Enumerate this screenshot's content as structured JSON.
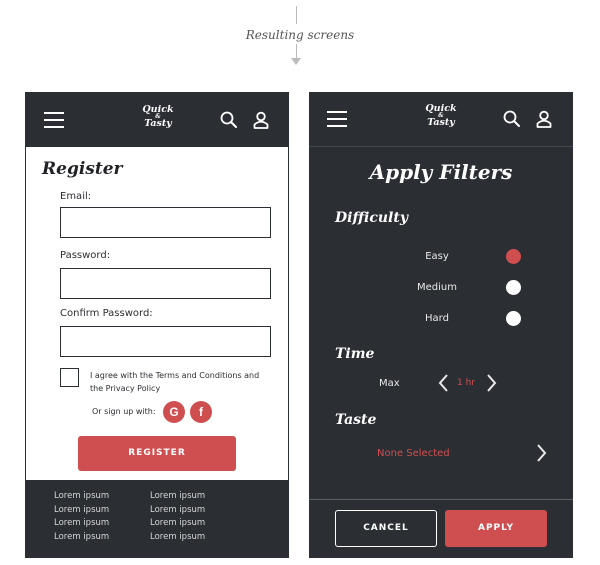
{
  "caption": "Resulting screens",
  "logo": {
    "line1": "Quick",
    "amp": "&",
    "line2": "Tasty"
  },
  "icons": {
    "menu": "hamburger-icon",
    "search": "search-icon",
    "user": "user-icon"
  },
  "colors": {
    "dark": "#2b2e33",
    "accent": "#cf4e50",
    "white": "#ffffff"
  },
  "register": {
    "title": "Register",
    "email_label": "Email:",
    "email_value": "",
    "password_label": "Password:",
    "password_value": "",
    "confirm_label": "Confirm Password:",
    "confirm_value": "",
    "agree_text": "I agree with the Terms and Conditions and the Privacy Policy",
    "social_label": "Or sign up with:",
    "google_glyph": "G",
    "facebook_glyph": "f",
    "register_button": "REGISTER",
    "footer": {
      "col1": [
        "Lorem ipsum",
        "Lorem ipsum",
        "Lorem ipsum",
        "Lorem ipsum"
      ],
      "col2": [
        "Lorem ipsum",
        "Lorem ipsum",
        "Lorem ipsum",
        "Lorem ipsum"
      ]
    }
  },
  "filters": {
    "title": "Apply Filters",
    "difficulty_heading": "Difficulty",
    "difficulty_options": [
      {
        "label": "Easy",
        "selected": true
      },
      {
        "label": "Medium",
        "selected": false
      },
      {
        "label": "Hard",
        "selected": false
      }
    ],
    "time_heading": "Time",
    "time_label": "Max",
    "time_value": "1 hr",
    "taste_heading": "Taste",
    "taste_value": "None Selected",
    "cancel_button": "CANCEL",
    "apply_button": "APPLY"
  }
}
